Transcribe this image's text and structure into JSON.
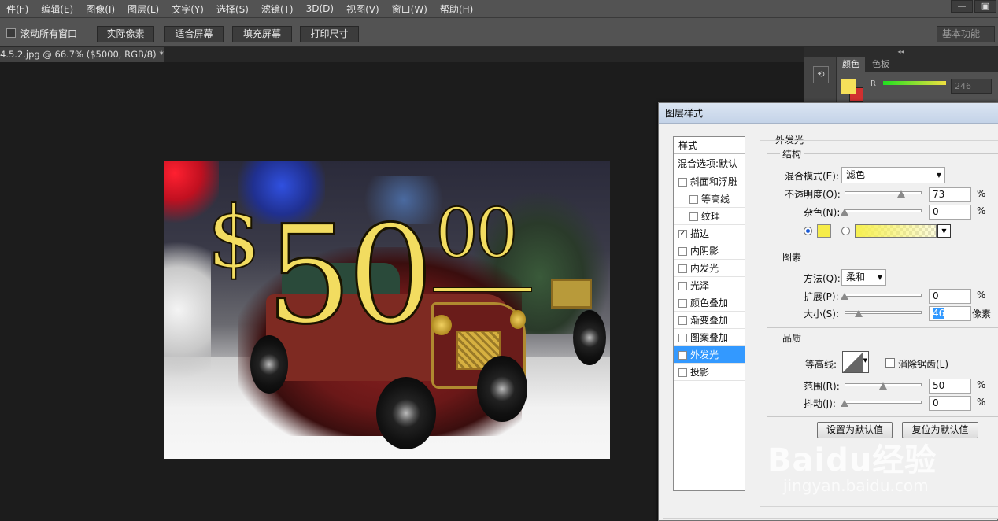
{
  "menu": [
    "件(F)",
    "编辑(E)",
    "图像(I)",
    "图层(L)",
    "文字(Y)",
    "选择(S)",
    "滤镜(T)",
    "3D(D)",
    "视图(V)",
    "窗口(W)",
    "帮助(H)"
  ],
  "window_buttons": [
    "—",
    "▣"
  ],
  "options_bar": {
    "scroll_all_label": "滚动所有窗口",
    "btn_actual": "实际像素",
    "btn_fit": "适合屏幕",
    "btn_fill": "填充屏幕",
    "btn_print": "打印尺寸",
    "workspace": "基本功能"
  },
  "document_tab": {
    "title": "4.5.2.jpg @ 66.7% ($5000, RGB/8) *",
    "close": "×"
  },
  "canvas_text": {
    "dollar": "$",
    "amount": "50",
    "cents": "00"
  },
  "panels": {
    "collapse": "◂◂",
    "tab_color": "颜色",
    "tab_swatches": "色板",
    "r_label": "R",
    "r_value": "246",
    "colors": {
      "foreground": "#f6e05a",
      "background": "#d03030"
    }
  },
  "dialog": {
    "title": "图层样式",
    "styles_header": "样式",
    "blend_defaults": "混合选项:默认",
    "styles": [
      {
        "label": "斜面和浮雕",
        "checked": false,
        "indent": false
      },
      {
        "label": "等高线",
        "checked": false,
        "indent": true
      },
      {
        "label": "纹理",
        "checked": false,
        "indent": true
      },
      {
        "label": "描边",
        "checked": true,
        "indent": false
      },
      {
        "label": "内阴影",
        "checked": false,
        "indent": false
      },
      {
        "label": "内发光",
        "checked": false,
        "indent": false
      },
      {
        "label": "光泽",
        "checked": false,
        "indent": false
      },
      {
        "label": "颜色叠加",
        "checked": false,
        "indent": false
      },
      {
        "label": "渐变叠加",
        "checked": false,
        "indent": false
      },
      {
        "label": "图案叠加",
        "checked": false,
        "indent": false
      },
      {
        "label": "外发光",
        "checked": true,
        "indent": false,
        "selected": true
      },
      {
        "label": "投影",
        "checked": false,
        "indent": false
      }
    ],
    "section_title": "外发光",
    "structure": {
      "title": "结构",
      "blend_mode_label": "混合模式(E):",
      "blend_mode_value": "滤色",
      "opacity_label": "不透明度(O):",
      "opacity_value": "73",
      "opacity_pct": 73,
      "noise_label": "杂色(N):",
      "noise_value": "0",
      "noise_pct": 0,
      "glow_color": "#f6ec48",
      "percent": "%"
    },
    "elements": {
      "title": "图素",
      "method_label": "方法(Q):",
      "method_value": "柔和",
      "spread_label": "扩展(P):",
      "spread_value": "0",
      "spread_pct": 0,
      "size_label": "大小(S):",
      "size_value": "46",
      "size_fraction": 0.18,
      "size_unit": "像素",
      "percent": "%"
    },
    "quality": {
      "title": "品质",
      "contour_label": "等高线:",
      "antialias_label": "消除锯齿(L)",
      "range_label": "范围(R):",
      "range_value": "50",
      "range_pct": 50,
      "jitter_label": "抖动(J):",
      "jitter_value": "0",
      "jitter_pct": 0,
      "percent": "%"
    },
    "btn_set_default": "设置为默认值",
    "btn_reset_default": "复位为默认值"
  },
  "watermark": {
    "brand": "Baidu经验",
    "url": "jingyan.baidu.com"
  }
}
